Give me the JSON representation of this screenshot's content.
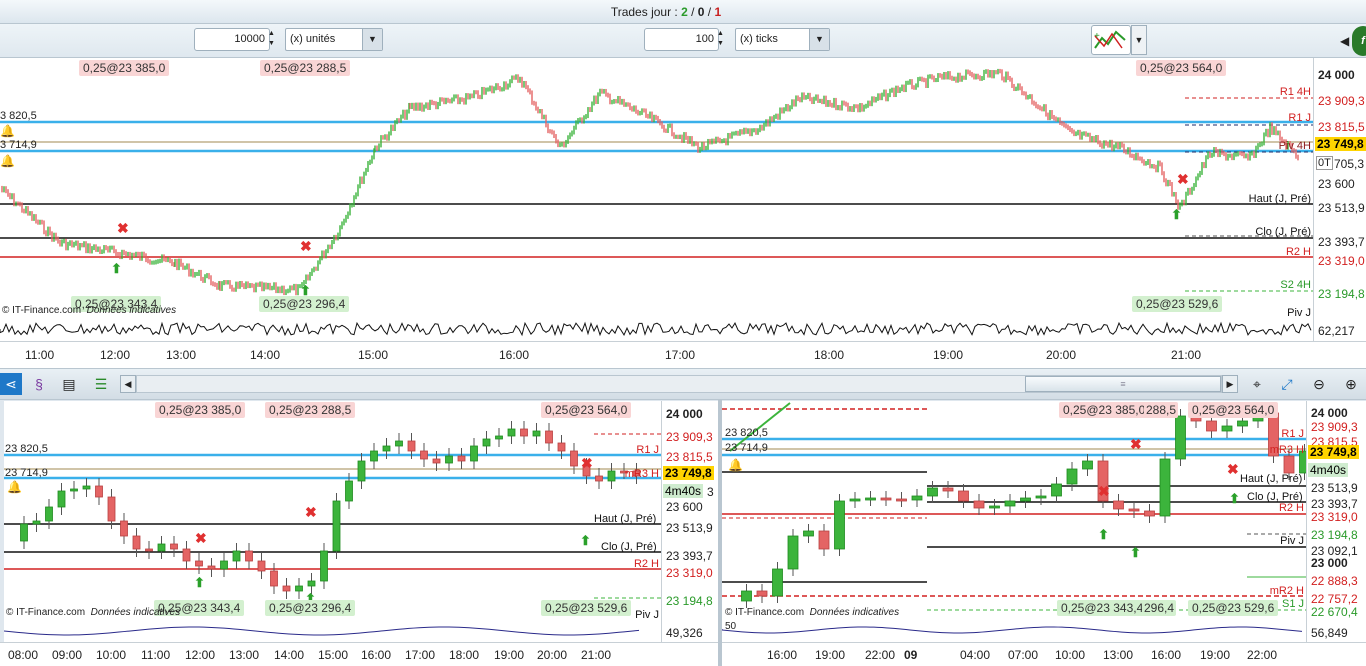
{
  "title": {
    "prefix": "Trades jour : ",
    "wins": "2",
    "sep1": " / ",
    "zero": "0",
    "sep2": " / ",
    "losses": "1"
  },
  "toolbar": {
    "qty_value": "10000",
    "qty_unit": "(x) unités",
    "tick_value": "100",
    "tick_unit": "(x) ticks"
  },
  "top": {
    "trades_top": [
      "0,25@23 385,0",
      "0,25@23 288,5",
      "0,25@23 564,0"
    ],
    "trades_bottom": [
      "0,25@23 343,4",
      "0,25@23 296,4",
      "0,25@23 529,6"
    ],
    "left_levels": [
      "3 820,5",
      "3 714,9"
    ],
    "pivot_labels": [
      "R1 4H",
      "R1 J",
      "Piv 4H",
      "Haut (J, Pré)",
      "Clo (J, Pré)",
      "R2 H",
      "S2 4H",
      "Piv J"
    ],
    "axis": [
      "24 000",
      "23 909,3",
      "23 815,5",
      "23 749,8",
      "0T",
      "705,3",
      "23 600",
      "23 513,9",
      "23 393,7",
      "23 319,0",
      "23 194,8",
      "62,217"
    ],
    "times": [
      "11:00",
      "12:00",
      "13:00",
      "14:00",
      "15:00",
      "16:00",
      "17:00",
      "18:00",
      "19:00",
      "20:00",
      "21:00"
    ],
    "footer": {
      "source": "© IT-Finance.com",
      "note": "Données indicatives"
    }
  },
  "bottom_left": {
    "trades_top": [
      "0,25@23 385,0",
      "0,25@23 288,5",
      "0,25@23 564,0"
    ],
    "trades_bottom": [
      "0,25@23 343,4",
      "0,25@23 296,4",
      "0,25@23 529,6"
    ],
    "left_levels": [
      "23 820,5",
      "23 714,9"
    ],
    "pivot_labels": [
      "R1 J",
      "mR3 H",
      "Haut (J, Pré)",
      "Clo (J, Pré)",
      "R2 H",
      "Piv J"
    ],
    "axis": [
      "24 000",
      "23 909,3",
      "23 815,5",
      "23 749,8",
      "4m40s",
      "3",
      "23 600",
      "23 513,9",
      "23 393,7",
      "23 319,0",
      "23 194,8",
      "49,326"
    ],
    "times": [
      "08:00",
      "09:00",
      "10:00",
      "11:00",
      "12:00",
      "13:00",
      "14:00",
      "15:00",
      "16:00",
      "17:00",
      "18:00",
      "19:00",
      "20:00",
      "21:00"
    ],
    "footer": {
      "source": "© IT-Finance.com",
      "note": "Données indicatives"
    }
  },
  "bottom_right": {
    "trades_top": [
      "0,25@23 385,0",
      "288,5",
      "0,25@23 564,0"
    ],
    "trades_bottom": [
      "0,25@23 343,4",
      "296,4",
      "0,25@23 529,6"
    ],
    "left_levels": [
      "23 820,5",
      "23 714,9"
    ],
    "pivot_labels": [
      "R1 J",
      "mR3 H",
      "Haut (J, Pré)",
      "Clo (J, Pré)",
      "R2 H",
      "Piv J",
      "mR2 H",
      "S1 J"
    ],
    "axis": [
      "24 000",
      "23 909,3",
      "23 815,5",
      "23 749,8",
      "4m40s",
      "23 513,9",
      "23 393,7",
      "23 319,0",
      "23 194,8",
      "23 092,1",
      "23 000",
      "22 888,3",
      "22 757,2",
      "22 670,4",
      "56,849"
    ],
    "times": [
      "16:00",
      "19:00",
      "22:00",
      "09",
      "04:00",
      "07:00",
      "10:00",
      "13:00",
      "16:00",
      "19:00",
      "22:00"
    ],
    "osc_label": "50",
    "footer": {
      "source": "© IT-Finance.com",
      "note": "Données indicatives"
    }
  },
  "colors": {
    "bull": "#3cb43c",
    "bear": "#e46464",
    "blue_level": "#3ab0ea",
    "red_level": "#d22020",
    "black_level": "#111111",
    "accent": "#ffd400"
  }
}
